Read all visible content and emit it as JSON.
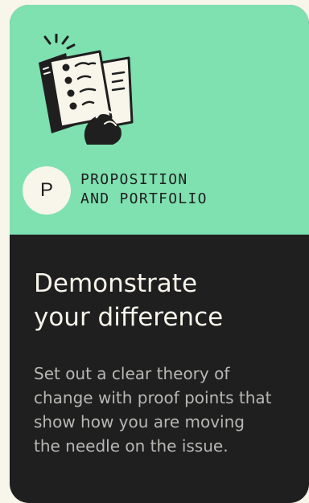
{
  "card": {
    "badge_letter": "P",
    "category_lines": [
      "PROPOSITION",
      "AND PORTFOLIO"
    ],
    "title_lines": [
      "Demonstrate",
      "your difference"
    ],
    "description_lines": [
      "Set out a clear theory of",
      "change with proof points that",
      "show how you are moving",
      "the needle on the issue."
    ],
    "illustration": "hand-holding-papers-icon"
  },
  "colors": {
    "page_background": "#f8f5ea",
    "accent_green": "#7fe0b0",
    "card_dark": "#1f1f20",
    "text_light": "#f8f5ea",
    "text_muted": "#b7b7b3"
  }
}
